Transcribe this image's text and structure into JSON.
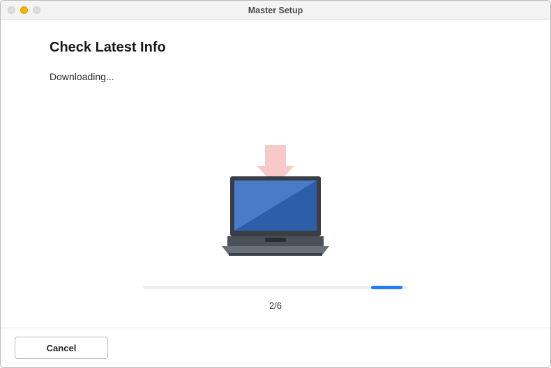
{
  "window": {
    "title": "Master Setup"
  },
  "header": {
    "heading": "Check Latest Info",
    "status": "Downloading..."
  },
  "progress": {
    "step_label": "2/6",
    "current_step": 2,
    "total_steps": 6,
    "indeterminate_segment": {
      "left_pct": 86,
      "width_pct": 12
    }
  },
  "icons": {
    "arrow": "download-arrow-icon",
    "device": "laptop-icon"
  },
  "colors": {
    "accent": "#1f7cff",
    "arrow": "#f7c9c9",
    "screen_light": "#4a7bc8",
    "screen_dark": "#2d5fa8",
    "body_dark": "#3a3f47",
    "body_mid": "#4b5059",
    "body_light": "#6a6f78"
  },
  "footer": {
    "cancel_label": "Cancel"
  }
}
